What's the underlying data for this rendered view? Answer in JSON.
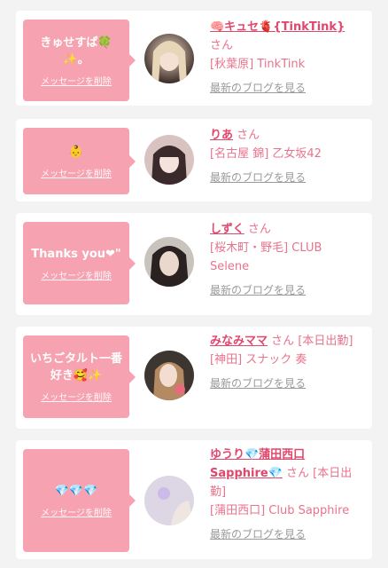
{
  "delete_label": "メッセージを削除",
  "san_suffix": "さん",
  "blog_label": "最新のブログを見る",
  "cards": [
    {
      "message": "きゅせすぱ🍀✨。",
      "name": "🧠キュセ🫀{TinkTink}",
      "status": "",
      "shop": "[秋葉原] TinkTink"
    },
    {
      "message": "👶",
      "name": "りあ",
      "status": "",
      "shop": "[名古屋 錦] 乙女坂42"
    },
    {
      "message": "Thanks you❤︎\"",
      "name": "しずく",
      "status": "",
      "shop": "[桜木町・野毛] CLUB Selene"
    },
    {
      "message": "いちごタルト一番好き🥰✨",
      "name": "みなみママ",
      "status": "[本日出勤]",
      "shop": "[神田] スナック 奏"
    },
    {
      "message": "💎💎💎",
      "name": "ゆうり💎蒲田西口Sapphire💎",
      "status": "[本日出勤]",
      "shop": "[蒲田西口] Club Sapphire"
    }
  ],
  "colors": {
    "bubble": "#f6a2b1",
    "name": "#e0476d",
    "text": "#e8738c",
    "link": "#9a9a9a",
    "background": "#f3f3f3"
  }
}
